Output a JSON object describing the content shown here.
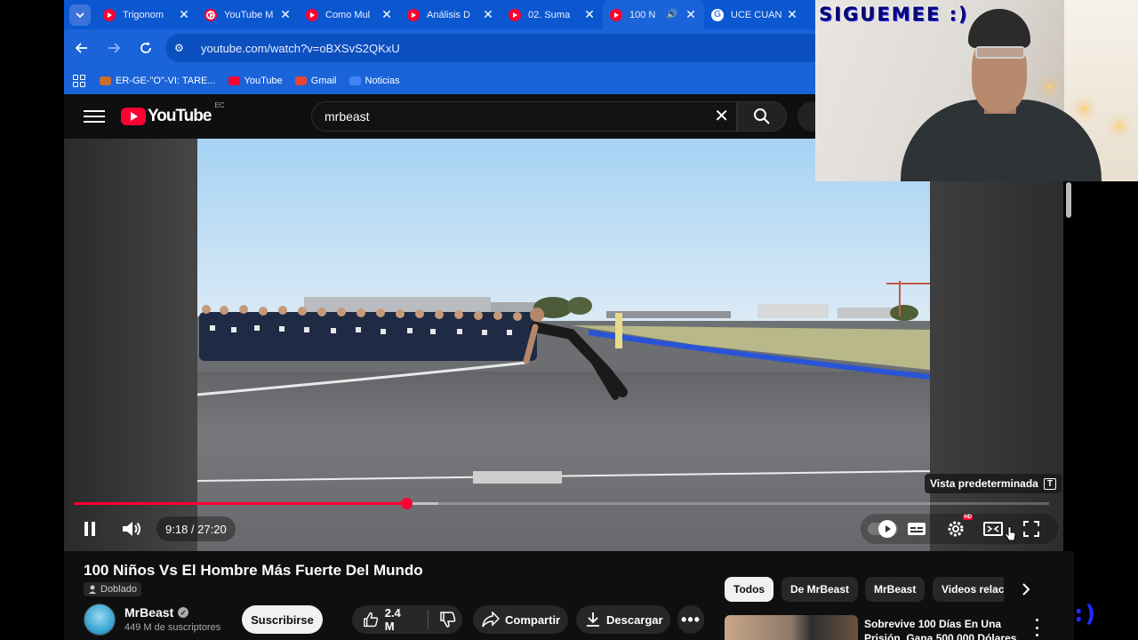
{
  "browser": {
    "tabs": [
      {
        "label": "Trigonom",
        "icon": "youtube-favicon",
        "active": false
      },
      {
        "label": "YouTube M",
        "icon": "youtube-music-favicon",
        "active": false
      },
      {
        "label": "Como Mul",
        "icon": "youtube-favicon",
        "active": false
      },
      {
        "label": "Análisis D",
        "icon": "youtube-favicon",
        "active": false
      },
      {
        "label": "02. Suma",
        "icon": "youtube-favicon",
        "active": false
      },
      {
        "label": "100 N",
        "icon": "youtube-favicon",
        "active": true
      },
      {
        "label": "UCE CUAN",
        "icon": "google-favicon",
        "active": false
      }
    ],
    "url": "youtube.com/watch?v=oBXSvS2QKxU",
    "bookmarks": [
      {
        "label": "ER-GE-\"O\"-VI: TARE...",
        "color": "#c96f2d"
      },
      {
        "label": "YouTube",
        "color": "#ff0033"
      },
      {
        "label": "Gmail",
        "color": "#ea4335"
      },
      {
        "label": "Noticias",
        "color": "#4285f4"
      }
    ]
  },
  "youtube": {
    "logo_text": "YouTube",
    "region": "EC",
    "search_value": "mrbeast"
  },
  "player": {
    "time": "9:18 / 27:20",
    "progress": 0.341,
    "buffered": 0.374,
    "tooltip": "Vista predeterminada",
    "tooltip_key": "T"
  },
  "video": {
    "title": "100 Niños Vs El Hombre Más Fuerte Del Mundo",
    "dubbed_label": "Doblado",
    "channel": "MrBeast",
    "subscribers": "449 M de suscriptores",
    "subscribe_label": "Suscribirse",
    "likes": "2.4 M",
    "share_label": "Compartir",
    "download_label": "Descargar"
  },
  "sidebar": {
    "chips": [
      "Todos",
      "De MrBeast",
      "MrBeast",
      "Videos relac"
    ],
    "recommendation_title": "Sobrevive 100 Días En Una Prisión, Gana 500,000 Dólares"
  },
  "overlay": {
    "webcam_caption": "SIGUEMEE :)",
    "corner_text": ":)"
  }
}
